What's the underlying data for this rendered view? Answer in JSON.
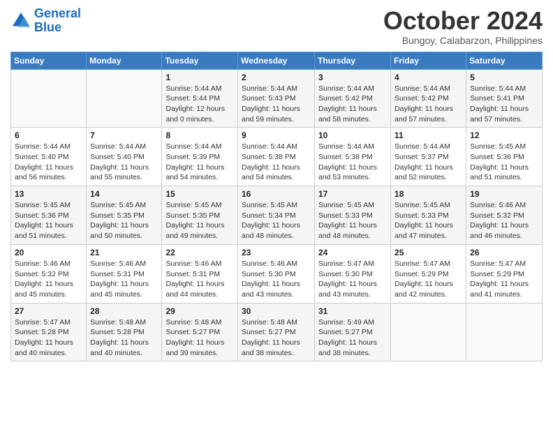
{
  "logo": {
    "line1": "General",
    "line2": "Blue"
  },
  "title": "October 2024",
  "subtitle": "Bungoy, Calabarzon, Philippines",
  "days_of_week": [
    "Sunday",
    "Monday",
    "Tuesday",
    "Wednesday",
    "Thursday",
    "Friday",
    "Saturday"
  ],
  "weeks": [
    [
      {
        "day": "",
        "info": ""
      },
      {
        "day": "",
        "info": ""
      },
      {
        "day": "1",
        "sunrise": "Sunrise: 5:44 AM",
        "sunset": "Sunset: 5:44 PM",
        "daylight": "Daylight: 12 hours and 0 minutes."
      },
      {
        "day": "2",
        "sunrise": "Sunrise: 5:44 AM",
        "sunset": "Sunset: 5:43 PM",
        "daylight": "Daylight: 11 hours and 59 minutes."
      },
      {
        "day": "3",
        "sunrise": "Sunrise: 5:44 AM",
        "sunset": "Sunset: 5:42 PM",
        "daylight": "Daylight: 11 hours and 58 minutes."
      },
      {
        "day": "4",
        "sunrise": "Sunrise: 5:44 AM",
        "sunset": "Sunset: 5:42 PM",
        "daylight": "Daylight: 11 hours and 57 minutes."
      },
      {
        "day": "5",
        "sunrise": "Sunrise: 5:44 AM",
        "sunset": "Sunset: 5:41 PM",
        "daylight": "Daylight: 11 hours and 57 minutes."
      }
    ],
    [
      {
        "day": "6",
        "sunrise": "Sunrise: 5:44 AM",
        "sunset": "Sunset: 5:40 PM",
        "daylight": "Daylight: 11 hours and 56 minutes."
      },
      {
        "day": "7",
        "sunrise": "Sunrise: 5:44 AM",
        "sunset": "Sunset: 5:40 PM",
        "daylight": "Daylight: 11 hours and 55 minutes."
      },
      {
        "day": "8",
        "sunrise": "Sunrise: 5:44 AM",
        "sunset": "Sunset: 5:39 PM",
        "daylight": "Daylight: 11 hours and 54 minutes."
      },
      {
        "day": "9",
        "sunrise": "Sunrise: 5:44 AM",
        "sunset": "Sunset: 5:38 PM",
        "daylight": "Daylight: 11 hours and 54 minutes."
      },
      {
        "day": "10",
        "sunrise": "Sunrise: 5:44 AM",
        "sunset": "Sunset: 5:38 PM",
        "daylight": "Daylight: 11 hours and 53 minutes."
      },
      {
        "day": "11",
        "sunrise": "Sunrise: 5:44 AM",
        "sunset": "Sunset: 5:37 PM",
        "daylight": "Daylight: 11 hours and 52 minutes."
      },
      {
        "day": "12",
        "sunrise": "Sunrise: 5:45 AM",
        "sunset": "Sunset: 5:36 PM",
        "daylight": "Daylight: 11 hours and 51 minutes."
      }
    ],
    [
      {
        "day": "13",
        "sunrise": "Sunrise: 5:45 AM",
        "sunset": "Sunset: 5:36 PM",
        "daylight": "Daylight: 11 hours and 51 minutes."
      },
      {
        "day": "14",
        "sunrise": "Sunrise: 5:45 AM",
        "sunset": "Sunset: 5:35 PM",
        "daylight": "Daylight: 11 hours and 50 minutes."
      },
      {
        "day": "15",
        "sunrise": "Sunrise: 5:45 AM",
        "sunset": "Sunset: 5:35 PM",
        "daylight": "Daylight: 11 hours and 49 minutes."
      },
      {
        "day": "16",
        "sunrise": "Sunrise: 5:45 AM",
        "sunset": "Sunset: 5:34 PM",
        "daylight": "Daylight: 11 hours and 48 minutes."
      },
      {
        "day": "17",
        "sunrise": "Sunrise: 5:45 AM",
        "sunset": "Sunset: 5:33 PM",
        "daylight": "Daylight: 11 hours and 48 minutes."
      },
      {
        "day": "18",
        "sunrise": "Sunrise: 5:45 AM",
        "sunset": "Sunset: 5:33 PM",
        "daylight": "Daylight: 11 hours and 47 minutes."
      },
      {
        "day": "19",
        "sunrise": "Sunrise: 5:46 AM",
        "sunset": "Sunset: 5:32 PM",
        "daylight": "Daylight: 11 hours and 46 minutes."
      }
    ],
    [
      {
        "day": "20",
        "sunrise": "Sunrise: 5:46 AM",
        "sunset": "Sunset: 5:32 PM",
        "daylight": "Daylight: 11 hours and 45 minutes."
      },
      {
        "day": "21",
        "sunrise": "Sunrise: 5:46 AM",
        "sunset": "Sunset: 5:31 PM",
        "daylight": "Daylight: 11 hours and 45 minutes."
      },
      {
        "day": "22",
        "sunrise": "Sunrise: 5:46 AM",
        "sunset": "Sunset: 5:31 PM",
        "daylight": "Daylight: 11 hours and 44 minutes."
      },
      {
        "day": "23",
        "sunrise": "Sunrise: 5:46 AM",
        "sunset": "Sunset: 5:30 PM",
        "daylight": "Daylight: 11 hours and 43 minutes."
      },
      {
        "day": "24",
        "sunrise": "Sunrise: 5:47 AM",
        "sunset": "Sunset: 5:30 PM",
        "daylight": "Daylight: 11 hours and 43 minutes."
      },
      {
        "day": "25",
        "sunrise": "Sunrise: 5:47 AM",
        "sunset": "Sunset: 5:29 PM",
        "daylight": "Daylight: 11 hours and 42 minutes."
      },
      {
        "day": "26",
        "sunrise": "Sunrise: 5:47 AM",
        "sunset": "Sunset: 5:29 PM",
        "daylight": "Daylight: 11 hours and 41 minutes."
      }
    ],
    [
      {
        "day": "27",
        "sunrise": "Sunrise: 5:47 AM",
        "sunset": "Sunset: 5:28 PM",
        "daylight": "Daylight: 11 hours and 40 minutes."
      },
      {
        "day": "28",
        "sunrise": "Sunrise: 5:48 AM",
        "sunset": "Sunset: 5:28 PM",
        "daylight": "Daylight: 11 hours and 40 minutes."
      },
      {
        "day": "29",
        "sunrise": "Sunrise: 5:48 AM",
        "sunset": "Sunset: 5:27 PM",
        "daylight": "Daylight: 11 hours and 39 minutes."
      },
      {
        "day": "30",
        "sunrise": "Sunrise: 5:48 AM",
        "sunset": "Sunset: 5:27 PM",
        "daylight": "Daylight: 11 hours and 38 minutes."
      },
      {
        "day": "31",
        "sunrise": "Sunrise: 5:49 AM",
        "sunset": "Sunset: 5:27 PM",
        "daylight": "Daylight: 11 hours and 38 minutes."
      },
      {
        "day": "",
        "info": ""
      },
      {
        "day": "",
        "info": ""
      }
    ]
  ]
}
